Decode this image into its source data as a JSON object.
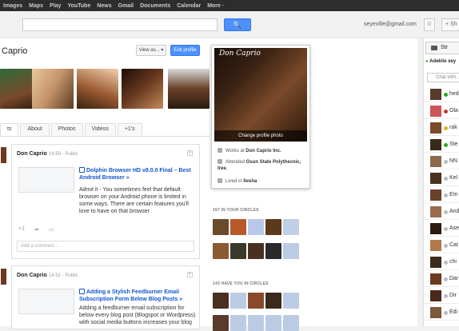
{
  "nav": [
    "Images",
    "Maps",
    "Play",
    "YouTube",
    "News",
    "Gmail",
    "Documents",
    "Calendar",
    "More ·"
  ],
  "header": {
    "search_icon": "search-icon",
    "search_button": "🔍",
    "email": "seyeville@gmail.com",
    "notifications": "0",
    "share_label": "+ Sh"
  },
  "profile": {
    "name": "Caprio",
    "view_as": "View as... ▾",
    "edit_profile": "Edit profile"
  },
  "tabs": [
    "ts",
    "About",
    "Photos",
    "Videos",
    "+1's"
  ],
  "posts": [
    {
      "author": "Don Caprio",
      "time": "16:50",
      "visibility": "Public",
      "link_title": "Dolphin Browser HD v8.0.0 Final – Best Android Browser »",
      "description": "Admit it - You sometimes feel that default browser on your Android phone is limited in some ways. There are certain features you'll love to have on that browser",
      "plus_one": "+1",
      "comment_placeholder": "Add a comment..."
    },
    {
      "author": "Don Caprio",
      "time": "14:51",
      "visibility": "Public",
      "link_title": "Adding a Stylish Feedburner Email Subscription Form Below Blog Posts »",
      "description": "Adding a feedburner email subscription for below every blog post (Blogspot or Wordpress) with social media buttons increases your blog"
    }
  ],
  "hover_card": {
    "photo_name": "Don Caprio",
    "change_photo": "Change profile photo",
    "works_prefix": "Works at ",
    "works_at": "Don Caprio Inc.",
    "attended_prefix": "Attended ",
    "attended": "Osun State Polythecnic, Iree.",
    "lived_prefix": "Lived in ",
    "lived_in": "Ilesha"
  },
  "circles": {
    "in_circles": "157 IN YOUR CIRCLES",
    "have_you": "143 HAVE YOU IN CIRCLES"
  },
  "right_panel": {
    "stream_label": "Str",
    "chat_header": "Adekile sey",
    "chat_search": "Chat with..."
  },
  "chat_contacts": [
    {
      "name": "hed",
      "status": "green"
    },
    {
      "name": "Ola",
      "status": "red"
    },
    {
      "name": "rak",
      "status": "yellow"
    },
    {
      "name": "Ste",
      "status": "green"
    },
    {
      "name": "NN",
      "status": "gray"
    },
    {
      "name": "Kel",
      "status": "gray"
    },
    {
      "name": "Em",
      "status": "gray"
    },
    {
      "name": "And",
      "status": "gray"
    },
    {
      "name": "Ase",
      "status": "gray"
    },
    {
      "name": "Cat",
      "status": "gray"
    },
    {
      "name": "chi",
      "status": "gray"
    },
    {
      "name": "Dar",
      "status": "gray"
    },
    {
      "name": "Dir",
      "status": "gray"
    },
    {
      "name": "Edi",
      "status": "gray"
    }
  ],
  "colors": {
    "accent": "#4d90fe",
    "link": "#1155cc",
    "nav_bg": "#2d2d2d"
  }
}
